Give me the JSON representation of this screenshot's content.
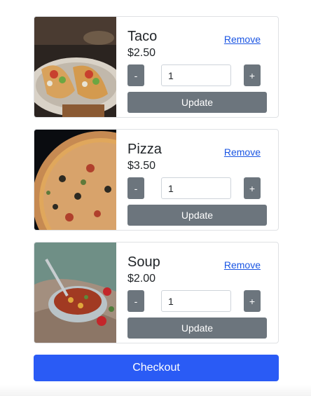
{
  "cart": {
    "items": [
      {
        "name": "Taco",
        "price": "$2.50",
        "quantity": "1",
        "remove_label": "Remove",
        "minus_label": "-",
        "plus_label": "+",
        "update_label": "Update",
        "image": "taco-photo"
      },
      {
        "name": "Pizza",
        "price": "$3.50",
        "quantity": "1",
        "remove_label": "Remove",
        "minus_label": "-",
        "plus_label": "+",
        "update_label": "Update",
        "image": "pizza-photo"
      },
      {
        "name": "Soup",
        "price": "$2.00",
        "quantity": "1",
        "remove_label": "Remove",
        "minus_label": "-",
        "plus_label": "+",
        "update_label": "Update",
        "image": "soup-photo"
      }
    ],
    "checkout_label": "Checkout"
  },
  "colors": {
    "primary": "#2a5bf5",
    "secondary": "#6c757d",
    "link": "#1a55e3",
    "border": "#dfe1e4"
  }
}
